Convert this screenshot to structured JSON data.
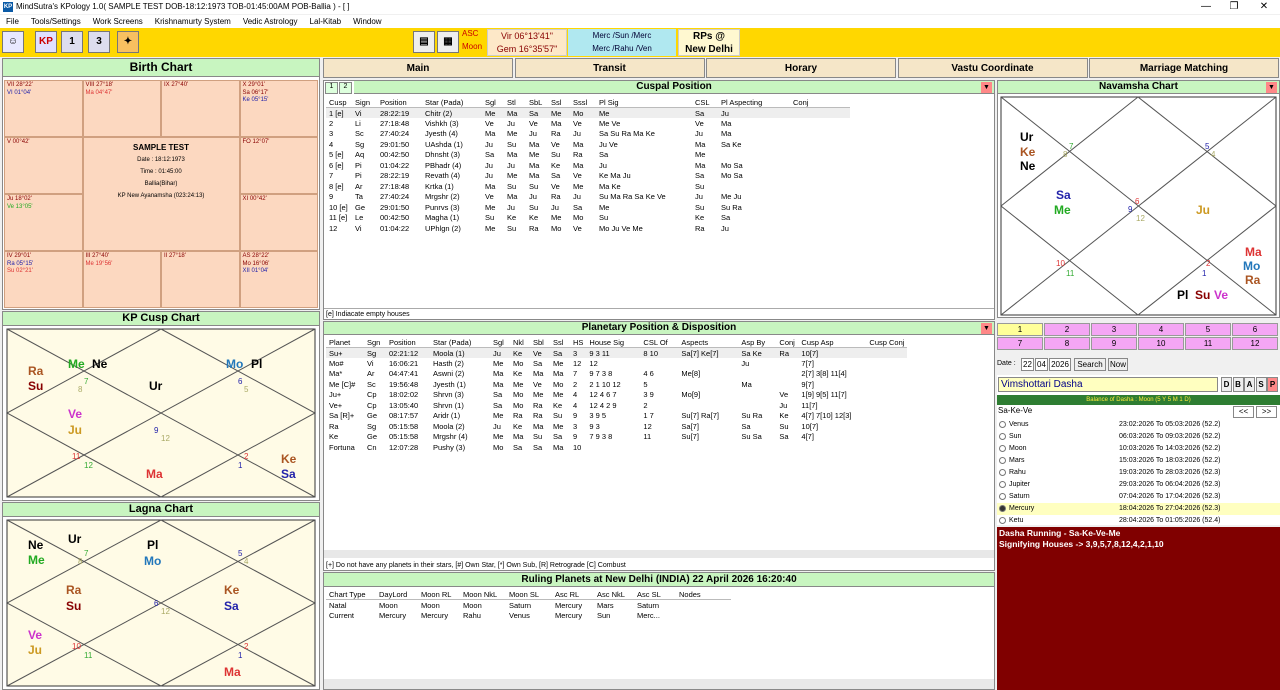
{
  "window": {
    "title": "MindSutra's KPology 1.0( SAMPLE TEST DOB-18:12:1973 TOB-01:45:00AM POB-Ballia ) - [ ]",
    "icon": "app-icon",
    "minimize": "—",
    "maximize": "❐",
    "close": "✕"
  },
  "menu": [
    "File",
    "Tools/Settings",
    "Work Screens",
    "Krishnamurty System",
    "Vedic Astrology",
    "Lal-Kitab",
    "Window"
  ],
  "toolbar": {
    "icons": [
      "person-icon",
      "KP",
      "1",
      "3",
      "compass-icon"
    ],
    "asc": "ASC",
    "moon": "Moon",
    "vir": "Vir 06°13'41\"",
    "gem": "Gem 16°35'57\"",
    "merc1": "Merc /Sun /Merc",
    "merc2": "Merc /Rahu /Ven",
    "rps1": "RPs @",
    "rps2": "New Delhi"
  },
  "birth": {
    "title": "Birth Chart",
    "name": "SAMPLE TEST",
    "date": "Date : 18:12:1973",
    "time": "Time : 01:45:00",
    "place": "Ballia(Bihar)",
    "ayan": "KP New Ayanamsha  (023:24:13)",
    "cells": [
      {
        "l1": "VII 28°22'",
        "l2": "VI 01°04'"
      },
      {
        "l1": "VIII 27°18'",
        "l2": "Ma 04°47'"
      },
      {
        "l1": "IX 27°40'",
        "l2": ""
      },
      {
        "l1": "X 29°01'",
        "l2": "Sa 06°17'",
        "l3": "Ke 05°15'"
      },
      {
        "l1": "V 00°42'",
        "l2": ""
      },
      {
        "l1": "FO 12°07'",
        "l2": ""
      },
      {
        "l1": "Ju 18°02'",
        "l2": "Ve 13°05'"
      },
      {
        "l1": "XI 00°42'",
        "l2": ""
      },
      {
        "l1": "IV 29°01'",
        "l2": "Ra 05°15'",
        "l3": "Su 02°21'"
      },
      {
        "l1": "III 27°40'",
        "l2": "Me 19°56'"
      },
      {
        "l1": "II 27°18'",
        "l2": ""
      },
      {
        "l1": "AS 28°22'",
        "l2": "Mo 16°06'",
        "l3": "XII 01°04'"
      }
    ]
  },
  "tabs": [
    "Main",
    "Transit",
    "Horary",
    "Vastu Coordinate",
    "Marriage Matching"
  ],
  "cuspal": {
    "title": "Cuspal Position",
    "headers": [
      "Cusp",
      "Sign",
      "Position",
      "Star (Pada)",
      "Sgl",
      "Stl",
      "SbL",
      "Ssl",
      "Sssl",
      "Pl Sig",
      "CSL",
      "Pl Aspecting",
      "Conj"
    ],
    "rows": [
      [
        "1 [e]",
        "Vi",
        "28:22:19",
        "Chitr (2)",
        "Me",
        "Ma",
        "Sa",
        "Me",
        "Mo",
        "Me",
        "Sa",
        "Ju",
        ""
      ],
      [
        "2",
        "Li",
        "27:18:48",
        "Vishkh (3)",
        "Ve",
        "Ju",
        "Ve",
        "Ma",
        "Ve",
        "Me Ve",
        "Ve",
        "Ma",
        ""
      ],
      [
        "3",
        "Sc",
        "27:40:24",
        "Jyesth (4)",
        "Ma",
        "Me",
        "Ju",
        "Ra",
        "Ju",
        "Sa Su Ra Ma Ke",
        "Ju",
        "Ma",
        ""
      ],
      [
        "4",
        "Sg",
        "29:01:50",
        "UAshda (1)",
        "Ju",
        "Su",
        "Ma",
        "Ve",
        "Ma",
        "Ju Ve",
        "Ma",
        "Sa Ke",
        ""
      ],
      [
        "5 [e]",
        "Aq",
        "00:42:50",
        "Dhnsht (3)",
        "Sa",
        "Ma",
        "Me",
        "Su",
        "Ra",
        "Sa",
        "Me",
        "",
        ""
      ],
      [
        "6 [e]",
        "Pi",
        "01:04:22",
        "PBhadr (4)",
        "Ju",
        "Ju",
        "Ma",
        "Ke",
        "Ma",
        "Ju",
        "Ma",
        "Mo Sa",
        ""
      ],
      [
        "7",
        "Pi",
        "28:22:19",
        "Revath (4)",
        "Ju",
        "Me",
        "Ma",
        "Sa",
        "Ve",
        "Ke Ma Ju",
        "Sa",
        "Mo Sa",
        ""
      ],
      [
        "8 [e]",
        "Ar",
        "27:18:48",
        "Krtka (1)",
        "Ma",
        "Su",
        "Su",
        "Ve",
        "Me",
        "Ma Ke",
        "Su",
        "",
        ""
      ],
      [
        "9",
        "Ta",
        "27:40:24",
        "Mrgshr (2)",
        "Ve",
        "Ma",
        "Ju",
        "Ra",
        "Ju",
        "Su Ma Ra Sa Ke Ve",
        "Ju",
        "Me Ju",
        ""
      ],
      [
        "10 [e]",
        "Ge",
        "29:01:50",
        "Punrvs (3)",
        "Me",
        "Ju",
        "Su",
        "Ju",
        "Sa",
        "Me",
        "Su",
        "Su Ra",
        ""
      ],
      [
        "11 [e]",
        "Le",
        "00:42:50",
        "Magha (1)",
        "Su",
        "Ke",
        "Ke",
        "Me",
        "Mo",
        "Su",
        "Ke",
        "Sa",
        ""
      ],
      [
        "12",
        "Vi",
        "01:04:22",
        "UPhlgn (2)",
        "Me",
        "Su",
        "Ra",
        "Mo",
        "Ve",
        "Mo Ju Ve Me",
        "Ra",
        "Ju",
        ""
      ]
    ],
    "note": "[e] Indiacate empty houses"
  },
  "planetary": {
    "title": "Planetary Position & Disposition",
    "headers": [
      "Planet",
      "Sgn",
      "Position",
      "Star (Pada)",
      "Sgl",
      "Nkl",
      "Sbl",
      "Ssl",
      "HS",
      "House Sig",
      "CSL Of",
      "Aspects",
      "Asp By",
      "Conj",
      "Cusp Asp",
      "Cusp Conj"
    ],
    "rows": [
      [
        "Su+",
        "Sg",
        "02:21:12",
        "Moola (1)",
        "Ju",
        "Ke",
        "Ve",
        "Sa",
        "3",
        "9 3 11",
        "8 10",
        "Sa[7] Ke[7]",
        "Sa Ke",
        "Ra",
        "10[7]",
        ""
      ],
      [
        "Mo#",
        "Vi",
        "16:06:21",
        "Hasth (2)",
        "Me",
        "Mo",
        "Sa",
        "Me",
        "12",
        "12",
        "",
        "",
        "Ju",
        "",
        "7[7]",
        ""
      ],
      [
        "Ma*",
        "Ar",
        "04:47:41",
        "Aswni (2)",
        "Ma",
        "Ke",
        "Ma",
        "Ma",
        "7",
        "9 7 3 8",
        "4 6",
        "Me[8]",
        "",
        "",
        "2[7] 3[8] 11[4]",
        ""
      ],
      [
        "Me [C]#",
        "Sc",
        "19:56:48",
        "Jyesth (1)",
        "Ma",
        "Me",
        "Ve",
        "Mo",
        "2",
        "2 1 10 12",
        "5",
        "",
        "Ma",
        "",
        "9[7]",
        ""
      ],
      [
        "Ju+",
        "Cp",
        "18:02:02",
        "Shrvn (3)",
        "Sa",
        "Mo",
        "Me",
        "Me",
        "4",
        "12 4 6 7",
        "3 9",
        "Mo[9]",
        "",
        "Ve",
        "1[9] 9[5] 11[7]",
        ""
      ],
      [
        "Ve+",
        "Cp",
        "13:05:40",
        "Shrvn (1)",
        "Sa",
        "Mo",
        "Ra",
        "Ke",
        "4",
        "12 4 2 9",
        "2",
        "",
        "",
        "Ju",
        "11[7]",
        ""
      ],
      [
        "Sa [R]+",
        "Ge",
        "08:17:57",
        "Aridr (1)",
        "Me",
        "Ra",
        "Ra",
        "Su",
        "9",
        "3 9 5",
        "1 7",
        "Su[7] Ra[7]",
        "Su Ra",
        "Ke",
        "4[7] 7[10] 12[3]",
        ""
      ],
      [
        "Ra",
        "Sg",
        "05:15:58",
        "Moola (2)",
        "Ju",
        "Ke",
        "Ma",
        "Me",
        "3",
        "9 3",
        "12",
        "Sa[7]",
        "Sa",
        "Su",
        "10[7]",
        ""
      ],
      [
        "Ke",
        "Ge",
        "05:15:58",
        "Mrgshr (4)",
        "Me",
        "Ma",
        "Su",
        "Sa",
        "9",
        "7 9 3 8",
        "11",
        "Su[7]",
        "Su Sa",
        "Sa",
        "4[7]",
        ""
      ],
      [
        "Fortuna",
        "Cn",
        "12:07:28",
        "Pushy (3)",
        "Mo",
        "Sa",
        "Sa",
        "Ma",
        "10",
        "",
        "",
        "",
        "",
        "",
        "",
        ""
      ]
    ],
    "note": "[+] Do not have any planets in their stars, [#] Own Star, [*] Own Sub, [R] Retrograde [C] Combust"
  },
  "ruling": {
    "title": "Ruling Planets at New Delhi (INDIA) 22 April 2026 16:20:40",
    "headers": [
      "Chart Type",
      "DayLord",
      "Moon RL",
      "Moon NkL",
      "Moon SL",
      "Asc RL",
      "Asc NkL",
      "Asc SL",
      "Nodes"
    ],
    "rows": [
      [
        "Natal",
        "Moon",
        "Moon",
        "Moon",
        "Saturn",
        "Mercury",
        "Mars",
        "Saturn",
        ""
      ],
      [
        "Current",
        "Mercury",
        "Mercury",
        "Rahu",
        "Venus",
        "Mercury",
        "Sun",
        "Merc...",
        ""
      ]
    ]
  },
  "kpcusp": {
    "title": "KP Cusp Chart"
  },
  "lagna": {
    "title": "Lagna Chart"
  },
  "navamsha": {
    "title": "Navamsha Chart"
  },
  "numgrid": [
    "1",
    "2",
    "3",
    "4",
    "5",
    "6",
    "7",
    "8",
    "9",
    "10",
    "11",
    "12"
  ],
  "datebar": {
    "label": "Date :",
    "day": "22",
    "month": "04",
    "year": "2026",
    "search": "Search",
    "now": "Now"
  },
  "dasha": {
    "select": "Vimshottari Dasha",
    "btns": [
      "D",
      "B",
      "A",
      "S",
      "P"
    ],
    "balance": "Balance of Dasha : Moon (5 Y 5 M 1 D)",
    "path": "Sa-Ke-Ve",
    "prev": "<<",
    "next": ">>",
    "rows": [
      {
        "name": "Venus",
        "period": "23:02:2026 To 05:03:2026 (52.2)"
      },
      {
        "name": "Sun",
        "period": "06:03:2026 To 09:03:2026 (52.2)"
      },
      {
        "name": "Moon",
        "period": "10:03:2026 To 14:03:2026 (52.2)"
      },
      {
        "name": "Mars",
        "period": "15:03:2026 To 18:03:2026 (52.2)"
      },
      {
        "name": "Rahu",
        "period": "19:03:2026 To 28:03:2026 (52.3)"
      },
      {
        "name": "Jupiter",
        "period": "29:03:2026 To 06:04:2026 (52.3)"
      },
      {
        "name": "Saturn",
        "period": "07:04:2026 To 17:04:2026 (52.3)"
      },
      {
        "name": "Mercury",
        "period": "18:04:2026 To 27:04:2026 (52.3)"
      },
      {
        "name": "Ketu",
        "period": "28:04:2026 To 01:05:2026 (52.4)"
      }
    ],
    "running": "Dasha Running - Sa-Ke-Ve-Me",
    "signifying": "Signifying Houses -> 3,9,5,7,8,12,4,2,1,10"
  },
  "colors": {
    "toolbar": "#ffd700",
    "header": "#c8f5c0",
    "birth_cell": "#fcd8c0",
    "chart_bg": "#fffbe6",
    "dasha_bg": "#800000",
    "grid_pink": "#f4a6f4",
    "grid_yellow": "#ffff99",
    "selected": "#ffffc0"
  }
}
